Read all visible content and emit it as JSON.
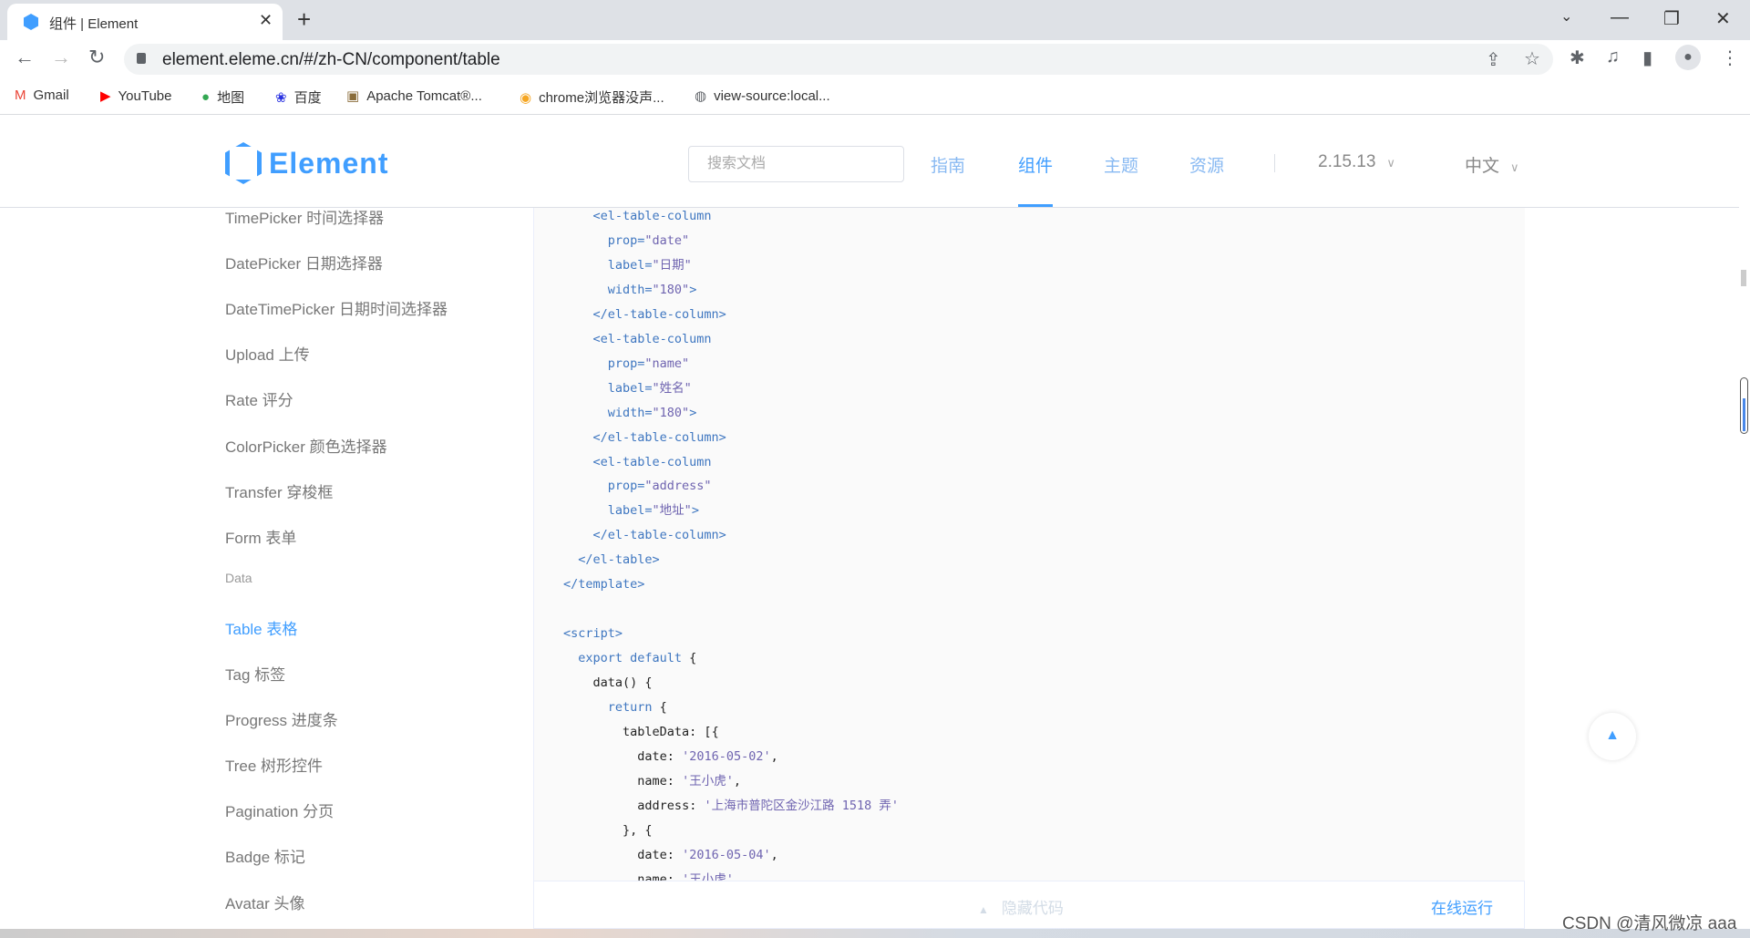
{
  "browser": {
    "tab_title": "组件 | Element",
    "url": "element.eleme.cn/#/zh-CN/component/table",
    "bookmarks": [
      {
        "label": "Gmail",
        "icon": "gmail-icon",
        "glyph": "M",
        "color": "#ea4335"
      },
      {
        "label": "YouTube",
        "icon": "youtube-icon",
        "glyph": "▶",
        "color": "#ff0000"
      },
      {
        "label": "地图",
        "icon": "maps-icon",
        "glyph": "●",
        "color": "#34a853"
      },
      {
        "label": "百度",
        "icon": "baidu-icon",
        "glyph": "❀",
        "color": "#2932e1"
      },
      {
        "label": "Apache Tomcat®...",
        "icon": "tomcat-icon",
        "glyph": "▣",
        "color": "#8a6d3b"
      },
      {
        "label": "chrome浏览器没声...",
        "icon": "chrome-help-icon",
        "glyph": "◉",
        "color": "#f5a623"
      },
      {
        "label": "view-source:local...",
        "icon": "globe-icon",
        "glyph": "◍",
        "color": "#5f6368"
      }
    ]
  },
  "header": {
    "logo": "Element",
    "search_placeholder": "搜索文档",
    "nav": [
      "指南",
      "组件",
      "主题",
      "资源"
    ],
    "active_nav": "组件",
    "version": "2.15.13",
    "language": "中文"
  },
  "sidebar": {
    "items": [
      {
        "label": "TimePicker 时间选择器"
      },
      {
        "label": "DatePicker 日期选择器"
      },
      {
        "label": "DateTimePicker 日期时间选择器"
      },
      {
        "label": "Upload 上传"
      },
      {
        "label": "Rate 评分"
      },
      {
        "label": "ColorPicker 颜色选择器"
      },
      {
        "label": "Transfer 穿梭框"
      },
      {
        "label": "Form 表单"
      },
      {
        "label": "Data",
        "group": true
      },
      {
        "label": "Table 表格",
        "active": true
      },
      {
        "label": "Tag 标签"
      },
      {
        "label": "Progress 进度条"
      },
      {
        "label": "Tree 树形控件"
      },
      {
        "label": "Pagination 分页"
      },
      {
        "label": "Badge 标记"
      },
      {
        "label": "Avatar 头像"
      }
    ]
  },
  "code": {
    "colors": {
      "tag": "#3e76c0",
      "string": "#6f64b0",
      "plain": "#222222"
    },
    "lines": [
      {
        "indent": 4,
        "seg": [
          [
            "tag",
            "<el-table-column"
          ]
        ]
      },
      {
        "indent": 6,
        "seg": [
          [
            "tag",
            "prop="
          ],
          [
            "str",
            "\"date\""
          ]
        ]
      },
      {
        "indent": 6,
        "seg": [
          [
            "tag",
            "label="
          ],
          [
            "str",
            "\"日期\""
          ]
        ]
      },
      {
        "indent": 6,
        "seg": [
          [
            "tag",
            "width="
          ],
          [
            "str",
            "\"180\""
          ],
          [
            "tag",
            ">"
          ]
        ]
      },
      {
        "indent": 4,
        "seg": [
          [
            "tag",
            "</el-table-column>"
          ]
        ]
      },
      {
        "indent": 4,
        "seg": [
          [
            "tag",
            "<el-table-column"
          ]
        ]
      },
      {
        "indent": 6,
        "seg": [
          [
            "tag",
            "prop="
          ],
          [
            "str",
            "\"name\""
          ]
        ]
      },
      {
        "indent": 6,
        "seg": [
          [
            "tag",
            "label="
          ],
          [
            "str",
            "\"姓名\""
          ]
        ]
      },
      {
        "indent": 6,
        "seg": [
          [
            "tag",
            "width="
          ],
          [
            "str",
            "\"180\""
          ],
          [
            "tag",
            ">"
          ]
        ]
      },
      {
        "indent": 4,
        "seg": [
          [
            "tag",
            "</el-table-column>"
          ]
        ]
      },
      {
        "indent": 4,
        "seg": [
          [
            "tag",
            "<el-table-column"
          ]
        ]
      },
      {
        "indent": 6,
        "seg": [
          [
            "tag",
            "prop="
          ],
          [
            "str",
            "\"address\""
          ]
        ]
      },
      {
        "indent": 6,
        "seg": [
          [
            "tag",
            "label="
          ],
          [
            "str",
            "\"地址\""
          ],
          [
            "tag",
            ">"
          ]
        ]
      },
      {
        "indent": 4,
        "seg": [
          [
            "tag",
            "</el-table-column>"
          ]
        ]
      },
      {
        "indent": 2,
        "seg": [
          [
            "tag",
            "</el-table>"
          ]
        ]
      },
      {
        "indent": 0,
        "seg": [
          [
            "tag",
            "</template>"
          ]
        ]
      },
      {
        "indent": 0,
        "seg": []
      },
      {
        "indent": 0,
        "seg": [
          [
            "tag",
            "<script>"
          ]
        ]
      },
      {
        "indent": 2,
        "seg": [
          [
            "tag",
            "export default"
          ],
          [
            "plain",
            " {"
          ]
        ]
      },
      {
        "indent": 4,
        "seg": [
          [
            "plain",
            "data() {"
          ]
        ]
      },
      {
        "indent": 6,
        "seg": [
          [
            "tag",
            "return"
          ],
          [
            "plain",
            " {"
          ]
        ]
      },
      {
        "indent": 8,
        "seg": [
          [
            "plain",
            "tableData: [{"
          ]
        ]
      },
      {
        "indent": 10,
        "seg": [
          [
            "plain",
            "date: "
          ],
          [
            "str",
            "'2016-05-02'"
          ],
          [
            "plain",
            ","
          ]
        ]
      },
      {
        "indent": 10,
        "seg": [
          [
            "plain",
            "name: "
          ],
          [
            "str",
            "'王小虎'"
          ],
          [
            "plain",
            ","
          ]
        ]
      },
      {
        "indent": 10,
        "seg": [
          [
            "plain",
            "address: "
          ],
          [
            "str",
            "'上海市普陀区金沙江路 1518 弄'"
          ]
        ]
      },
      {
        "indent": 8,
        "seg": [
          [
            "plain",
            "}, {"
          ]
        ]
      },
      {
        "indent": 10,
        "seg": [
          [
            "plain",
            "date: "
          ],
          [
            "str",
            "'2016-05-04'"
          ],
          [
            "plain",
            ","
          ]
        ]
      },
      {
        "indent": 10,
        "seg": [
          [
            "plain",
            "name: "
          ],
          [
            "str",
            "'王小虎'"
          ],
          [
            "plain",
            ","
          ]
        ]
      }
    ]
  },
  "controls": {
    "hide_code": "隐藏代码",
    "run_online": "在线运行"
  },
  "watermark": "CSDN @清风微凉 aaa"
}
